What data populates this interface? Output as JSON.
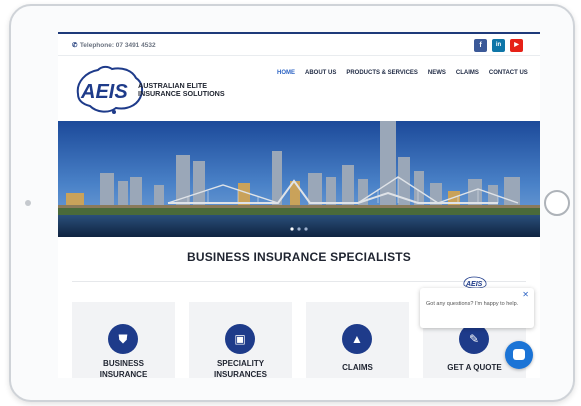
{
  "topbar": {
    "phone": "Telephone: 07 3491 4532",
    "social": [
      {
        "icon": "facebook-icon",
        "glyph": "f",
        "color": "#3b5998"
      },
      {
        "icon": "linkedin-icon",
        "glyph": "in",
        "color": "#0e76a8"
      },
      {
        "icon": "youtube-icon",
        "glyph": "▶",
        "color": "#e62117"
      }
    ]
  },
  "logo": {
    "mark": "AEIS",
    "line1": "AUSTRALIAN ELITE",
    "line2": "INSURANCE SOLUTIONS"
  },
  "nav": {
    "items": [
      "HOME",
      "ABOUT US",
      "PRODUCTS & SERVICES",
      "NEWS",
      "CLAIMS",
      "CONTACT US"
    ],
    "active": "HOME"
  },
  "section": {
    "title": "BUSINESS INSURANCE SPECIALISTS"
  },
  "cards": [
    {
      "label_line1": "BUSINESS",
      "label_line2": "INSURANCE",
      "icon": "shield-icon",
      "glyph": "⛊"
    },
    {
      "label_line1": "SPECIALITY",
      "label_line2": "INSURANCES",
      "icon": "briefcase-icon",
      "glyph": "▣"
    },
    {
      "label_line1": "CLAIMS",
      "label_line2": "",
      "icon": "warning-icon",
      "glyph": "▲"
    },
    {
      "label_line1": "GET A QUOTE",
      "label_line2": "",
      "icon": "pencil-icon",
      "glyph": "✎"
    }
  ],
  "chat": {
    "message": "Got any questions? I'm happy to help.",
    "logo_text": "AEIS"
  },
  "colors": {
    "brand": "#1e3b8a",
    "accent": "#2d64c4",
    "chat": "#1b74d6"
  }
}
